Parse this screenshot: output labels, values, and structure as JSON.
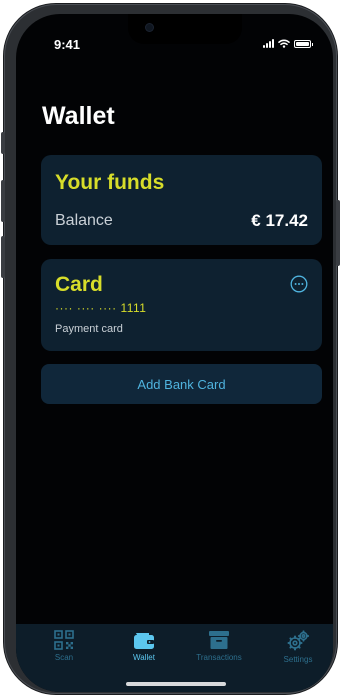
{
  "status_bar": {
    "time": "9:41"
  },
  "page": {
    "title": "Wallet"
  },
  "funds_card": {
    "title": "Your funds",
    "balance_label": "Balance",
    "balance_value": "€ 17.42"
  },
  "payment_card": {
    "title": "Card",
    "masked_number": "···· ···· ···· 1111",
    "subtitle": "Payment card",
    "more_icon": "ellipsis-circle-icon"
  },
  "add_card_button": {
    "label": "Add Bank Card"
  },
  "tab_bar": {
    "tabs": [
      {
        "label": "Scan",
        "icon": "qr-code-icon",
        "active": false
      },
      {
        "label": "Wallet",
        "icon": "wallet-icon",
        "active": true
      },
      {
        "label": "Transactions",
        "icon": "archive-box-icon",
        "active": false
      },
      {
        "label": "Settings",
        "icon": "gears-icon",
        "active": false
      }
    ]
  },
  "colors": {
    "background": "#020305",
    "card_bg": "#0e2130",
    "accent_yellow": "#d7dd2a",
    "accent_blue": "#4fb3de",
    "tab_inactive": "#2d6f8d",
    "tab_active": "#5cc7ef"
  }
}
